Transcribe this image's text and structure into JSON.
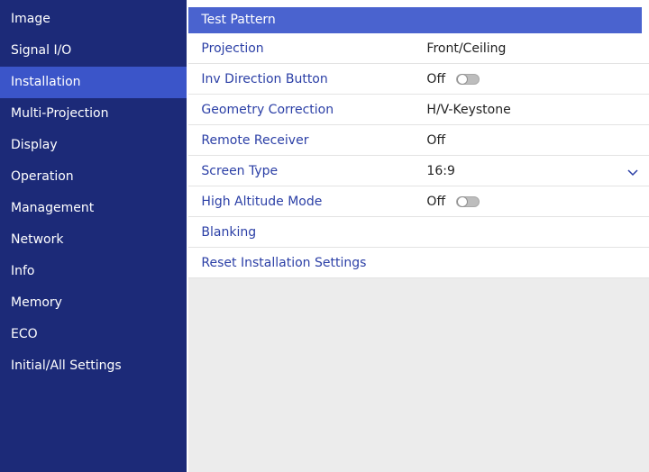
{
  "sidebar": {
    "items": [
      {
        "label": "Image"
      },
      {
        "label": "Signal I/O"
      },
      {
        "label": "Installation"
      },
      {
        "label": "Multi-Projection"
      },
      {
        "label": "Display"
      },
      {
        "label": "Operation"
      },
      {
        "label": "Management"
      },
      {
        "label": "Network"
      },
      {
        "label": "Info"
      },
      {
        "label": "Memory"
      },
      {
        "label": "ECO"
      },
      {
        "label": "Initial/All Settings"
      }
    ],
    "active": "Installation"
  },
  "main": {
    "header_item": "Test Pattern",
    "rows": [
      {
        "label": "Projection",
        "value": "Front/Ceiling"
      },
      {
        "label": "Inv Direction Button",
        "value": "Off"
      },
      {
        "label": "Geometry Correction",
        "value": "H/V-Keystone"
      },
      {
        "label": "Remote Receiver",
        "value": "Off"
      },
      {
        "label": "Screen Type",
        "value": "16:9"
      },
      {
        "label": "High Altitude Mode",
        "value": "Off"
      },
      {
        "label": "Blanking",
        "value": ""
      },
      {
        "label": "Reset Installation Settings",
        "value": ""
      }
    ]
  },
  "colors": {
    "sidebar_bg": "#1c2a78",
    "sidebar_active": "#3b55c9",
    "header_item_bg": "#4a63cf",
    "row_label": "#2b3fa6",
    "panel_bg": "#ececec"
  },
  "icons": {
    "toggle": "toggle-switch-icon",
    "dropdown": "chevron-down-icon"
  }
}
